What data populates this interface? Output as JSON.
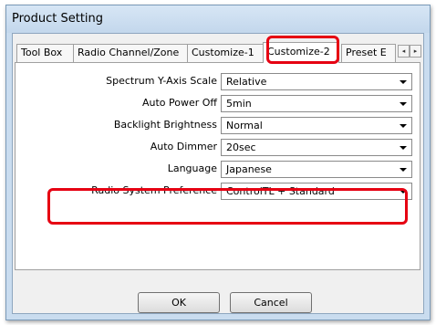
{
  "window": {
    "title": "Product Setting"
  },
  "tabs": [
    {
      "label": "Tool Box"
    },
    {
      "label": "Radio Channel/Zone"
    },
    {
      "label": "Customize-1"
    },
    {
      "label": "Customize-2",
      "active": true
    },
    {
      "label": "Preset E"
    }
  ],
  "tab_scroll": {
    "left": "◂",
    "right": "▸"
  },
  "settings": [
    {
      "label": "Spectrum Y-Axis Scale",
      "value": "Relative"
    },
    {
      "label": "Auto Power Off",
      "value": "5min"
    },
    {
      "label": "Backlight Brightness",
      "value": "Normal"
    },
    {
      "label": "Auto Dimmer",
      "value": "20sec"
    },
    {
      "label": "Language",
      "value": "Japanese"
    },
    {
      "label": "Radio System Preference",
      "value": "ControlTL + Standard"
    }
  ],
  "buttons": {
    "ok": "OK",
    "cancel": "Cancel"
  },
  "colors": {
    "highlight": "#e60012",
    "titlebar": "#c9dcef"
  }
}
